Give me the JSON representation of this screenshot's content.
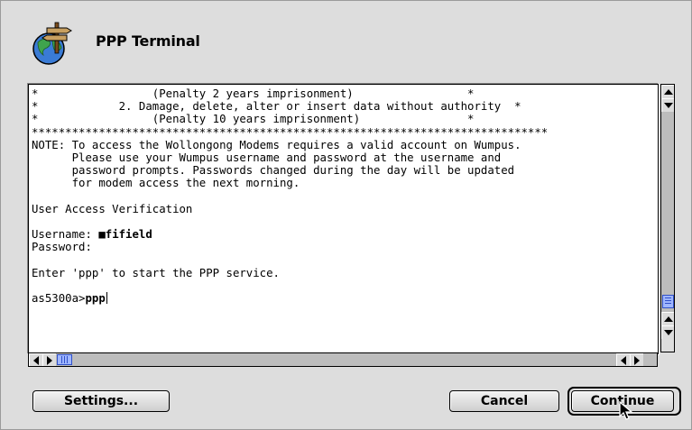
{
  "window": {
    "title": "PPP Terminal",
    "icon": "globe-signpost-icon"
  },
  "terminal": {
    "lines": [
      "*                 (Penalty 2 years imprisonment)                 *",
      "*            2. Damage, delete, alter or insert data without authority  *",
      "*                 (Penalty 10 years imprisonment)                *",
      "*****************************************************************************",
      "NOTE: To access the Wollongong Modems requires a valid account on Wumpus.",
      "      Please use your Wumpus username and password at the username and",
      "      password prompts. Passwords changed during the day will be updated",
      "      for modem access the next morning.",
      "",
      "User Access Verification",
      "",
      "Username: ",
      "Password:",
      "",
      "Enter 'ppp' to start the PPP service.",
      "",
      "as5300a>"
    ],
    "username_value": "■fifield",
    "prompt_input": "ppp"
  },
  "buttons": {
    "settings": "Settings...",
    "cancel": "Cancel",
    "continue": "Continue"
  },
  "colors": {
    "scroll_thumb": "#9fb6ff",
    "background": "#dddddd"
  }
}
